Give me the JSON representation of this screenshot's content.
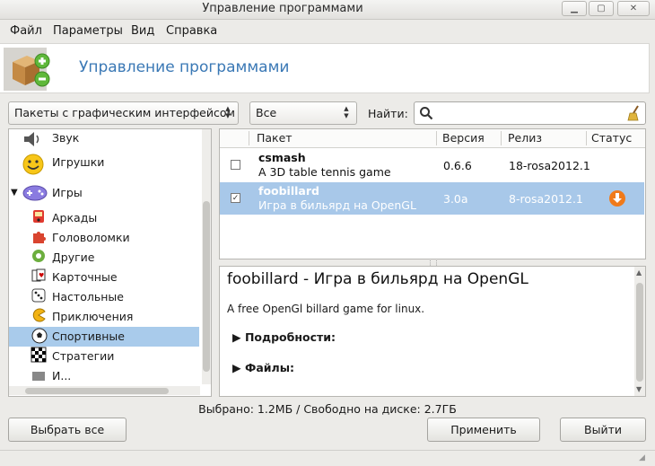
{
  "window": {
    "title": "Управление программами"
  },
  "menu": [
    "Файл",
    "Параметры",
    "Вид",
    "Справка"
  ],
  "banner": {
    "title": "Управление программами"
  },
  "filters": {
    "type_combo": "Пакеты с графическим интерфейсом",
    "status_combo": "Все",
    "search_label": "Найти:",
    "search_value": ""
  },
  "categories": [
    {
      "label": "Звук",
      "icon": "speaker-icon",
      "level": 0
    },
    {
      "label": "Игрушки",
      "icon": "smiley-icon",
      "level": 0
    },
    {
      "label": "Игры",
      "icon": "gamepad-icon",
      "level": 0,
      "expanded": true
    },
    {
      "label": "Аркады",
      "icon": "arcade-icon",
      "level": 1
    },
    {
      "label": "Головоломки",
      "icon": "puzzle-icon",
      "level": 1
    },
    {
      "label": "Другие",
      "icon": "other-games-icon",
      "level": 1
    },
    {
      "label": "Карточные",
      "icon": "cards-icon",
      "level": 1
    },
    {
      "label": "Настольные",
      "icon": "dice-icon",
      "level": 1
    },
    {
      "label": "Приключения",
      "icon": "pacman-icon",
      "level": 1
    },
    {
      "label": "Спортивные",
      "icon": "ball-icon",
      "level": 1,
      "selected": true
    },
    {
      "label": "Стратегии",
      "icon": "chessboard-icon",
      "level": 1
    },
    {
      "label": "И...",
      "icon": "partial-icon",
      "level": 1
    }
  ],
  "table": {
    "headers": {
      "package": "Пакет",
      "version": "Версия",
      "release": "Релиз",
      "status": "Статус"
    },
    "rows": [
      {
        "name": "csmash",
        "summary": "A 3D table tennis game",
        "version": "0.6.6",
        "release": "18-rosa2012.1",
        "checked": false,
        "selected": false,
        "status_icon": ""
      },
      {
        "name": "foobillard",
        "summary": "Игра в бильярд на OpenGL",
        "version": "3.0a",
        "release": "8-rosa2012.1",
        "checked": true,
        "selected": true,
        "status_icon": "install-download-icon"
      }
    ]
  },
  "details": {
    "heading": "foobillard - Игра в бильярд на OpenGL",
    "description": "A free OpenGl billard game for linux.",
    "sections": [
      "Подробности:",
      "Файлы:"
    ]
  },
  "status_bar": {
    "text": "Выбрано: 1.2МБ / Свободно на диске: 2.7ГБ"
  },
  "buttons": {
    "select_all": "Выбрать все",
    "apply": "Применить",
    "quit": "Выйти"
  },
  "colors": {
    "selection": "#a8c8e9",
    "banner_title": "#3a78b5",
    "install_orange": "#f07a1a"
  }
}
